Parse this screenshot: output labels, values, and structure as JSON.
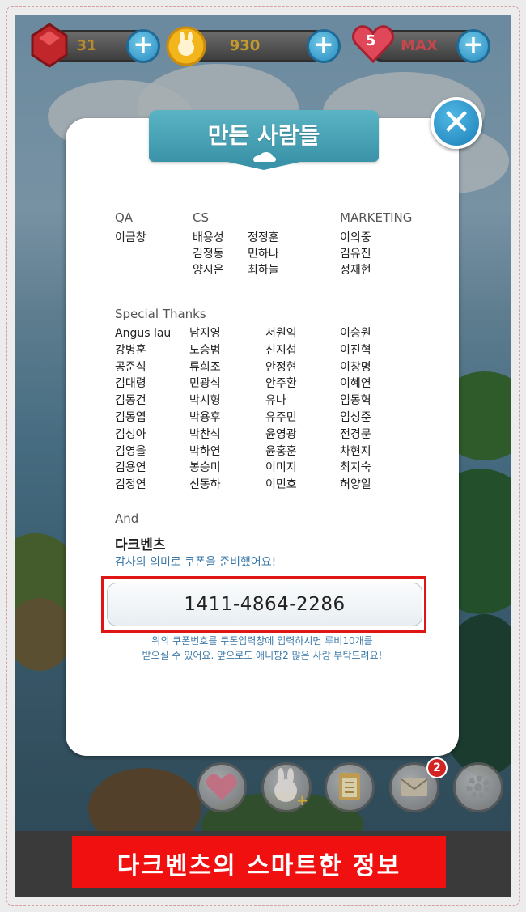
{
  "stats": {
    "ruby": "31",
    "coins": "930",
    "hearts_count": "5",
    "hearts_label": "MAX"
  },
  "modal": {
    "title": "만든 사람들",
    "sections": {
      "qa": {
        "heading": "QA",
        "names": [
          "이금창"
        ]
      },
      "cs": {
        "heading": "CS",
        "names_a": [
          "배용성",
          "김정동",
          "양시은"
        ],
        "names_b": [
          "정정훈",
          "민하나",
          "최하늘"
        ]
      },
      "marketing": {
        "heading": "MARKETING",
        "names": [
          "이의중",
          "김유진",
          "정재현"
        ]
      },
      "special": {
        "heading": "Special Thanks",
        "col1": [
          "Angus lau",
          "강병훈",
          "공준식",
          "김대령",
          "김동건",
          "김동엽",
          "김성아",
          "김영을",
          "김용연",
          "김정연"
        ],
        "col2": [
          "남지영",
          "노승범",
          "류희조",
          "민광식",
          "박시형",
          "박용후",
          "박찬석",
          "박하연",
          "봉승미",
          "신동하"
        ],
        "col3": [
          "서원익",
          "신지섭",
          "안정현",
          "안주환",
          "유나",
          "유주민",
          "윤영광",
          "윤홍훈",
          "이미지",
          "이민호"
        ],
        "col4": [
          "이승원",
          "이진혁",
          "이창명",
          "이혜연",
          "임동혁",
          "임성준",
          "전경문",
          "차현지",
          "최지숙",
          "허양일"
        ]
      },
      "and": {
        "heading": "And",
        "company": "다크벤츠",
        "message": "감사의 의미로 쿠폰을 준비했어요!"
      }
    },
    "coupon_code": "1411-4864-2286",
    "note_line1": "위의 쿠폰번호를 쿠폰입력창에 입력하시면 루비10개를",
    "note_line2": "받으실 수 있어요. 앞으로도 애니팡2 많은 사랑 부탁드려요!"
  },
  "mail_badge": "2",
  "footer": "다크벤츠의 스마트한 정보",
  "colors": {
    "accent_blue": "#2a8cc0",
    "ribbon": "#4aa5b8",
    "highlight_red": "#e01515",
    "note_blue": "#3a78a8"
  }
}
